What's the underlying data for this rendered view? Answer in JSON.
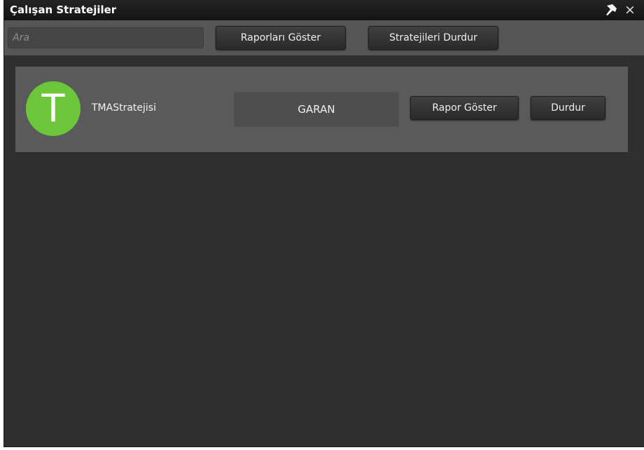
{
  "window": {
    "title": "Çalışan Stratejiler",
    "pin_icon": "pin-icon",
    "close_icon": "close-icon",
    "close_glyph": "×"
  },
  "toolbar": {
    "search_placeholder": "Ara",
    "search_value": "",
    "show_reports_label": "Raporları Göster",
    "stop_strategies_label": "Stratejileri Durdur"
  },
  "strategies": [
    {
      "avatar_letter": "T",
      "avatar_color": "#6cc63a",
      "name": "TMAStratejisi",
      "symbol": "GARAN",
      "show_report_label": "Rapor Göster",
      "stop_label": "Durdur"
    }
  ],
  "colors": {
    "titlebar": "#1a1a1a",
    "toolbar": "#565656",
    "background": "#2f2f2f",
    "row": "#5a5a5a"
  }
}
